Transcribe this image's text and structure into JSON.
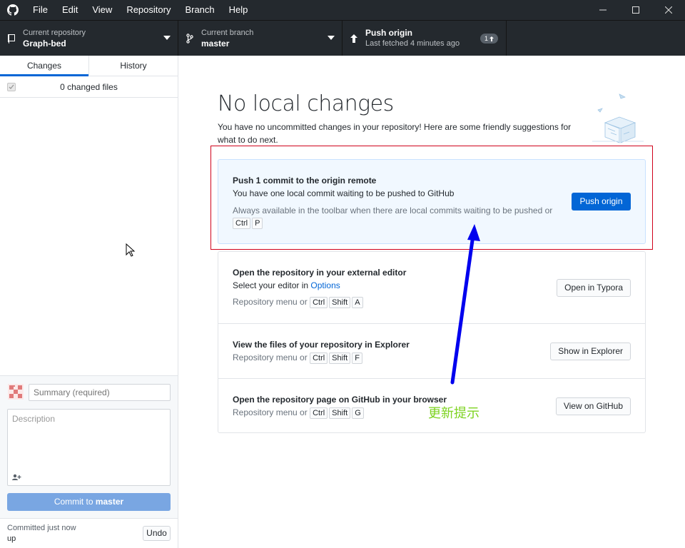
{
  "menu": [
    "File",
    "Edit",
    "View",
    "Repository",
    "Branch",
    "Help"
  ],
  "toolbar": {
    "repo_label": "Current repository",
    "repo_name": "Graph-bed",
    "branch_label": "Current branch",
    "branch_name": "master",
    "push_title": "Push origin",
    "push_sub": "Last fetched 4 minutes ago",
    "push_badge": "1"
  },
  "sidebar": {
    "tab_changes": "Changes",
    "tab_history": "History",
    "changed_files": "0 changed files",
    "summary_placeholder": "Summary (required)",
    "description_placeholder": "Description",
    "commit_prefix": "Commit to ",
    "commit_branch": "master",
    "committed_line1": "Committed just now",
    "committed_line2": "up",
    "undo": "Undo"
  },
  "main": {
    "title": "No local changes",
    "intro": "You have no uncommitted changes in your repository! Here are some friendly suggestions for what to do next.",
    "push_card": {
      "title": "Push 1 commit to the origin remote",
      "desc": "You have one local commit waiting to be pushed to GitHub",
      "hint": "Always available in the toolbar when there are local commits waiting to be pushed or",
      "keys": [
        "Ctrl",
        "P"
      ],
      "button": "Push origin"
    },
    "editor_card": {
      "title": "Open the repository in your external editor",
      "desc_prefix": "Select your editor in ",
      "desc_link": "Options",
      "hint": "Repository menu or",
      "keys": [
        "Ctrl",
        "Shift",
        "A"
      ],
      "button": "Open in Typora"
    },
    "explorer_card": {
      "title": "View the files of your repository in Explorer",
      "hint": "Repository menu or",
      "keys": [
        "Ctrl",
        "Shift",
        "F"
      ],
      "button": "Show in Explorer"
    },
    "github_card": {
      "title": "Open the repository page on GitHub in your browser",
      "hint": "Repository menu or",
      "keys": [
        "Ctrl",
        "Shift",
        "G"
      ],
      "button": "View on GitHub"
    }
  },
  "annotation": "更新提示",
  "colors": {
    "accent": "#0366d6",
    "highlight_border": "#d0021b",
    "arrow": "#0000ee",
    "annotation": "#7ed321"
  }
}
